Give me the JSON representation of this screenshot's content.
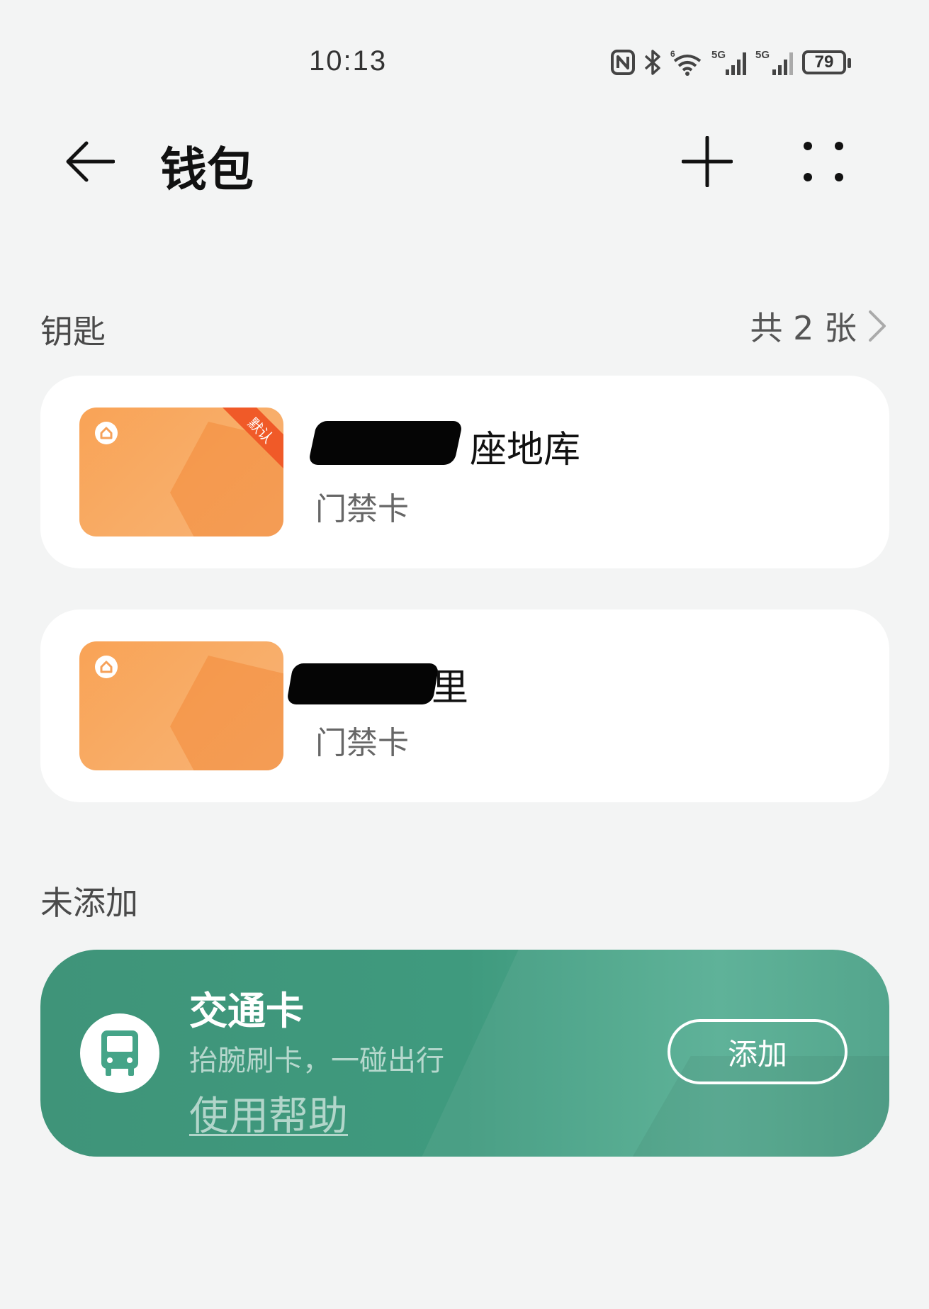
{
  "status_bar": {
    "time": "10:13",
    "battery": "79",
    "icons": [
      "nfc-icon",
      "bluetooth-icon",
      "wifi-icon",
      "signal-5g-icon",
      "signal-5g-icon",
      "battery-icon"
    ]
  },
  "header": {
    "title": "钱包",
    "back_icon": "arrow-left-icon",
    "add_icon": "plus-icon",
    "more_icon": "four-dots-icon"
  },
  "keys_section": {
    "title": "钥匙",
    "count_label": "共 2 张",
    "cards": [
      {
        "name_visible": "座地库",
        "type": "门禁卡",
        "badge": "默认"
      },
      {
        "name_visible": "里",
        "type": "门禁卡"
      }
    ]
  },
  "not_added_section": {
    "title": "未添加",
    "transit_card": {
      "title": "交通卡",
      "subtitle": "抬腕刷卡，一碰出行",
      "help_link": "使用帮助",
      "add_button": "添加"
    }
  },
  "colors": {
    "background": "#f3f4f4",
    "card_orange": "#f9a356",
    "badge_red": "#f05a28",
    "transit_green": "#3f9a7e"
  }
}
